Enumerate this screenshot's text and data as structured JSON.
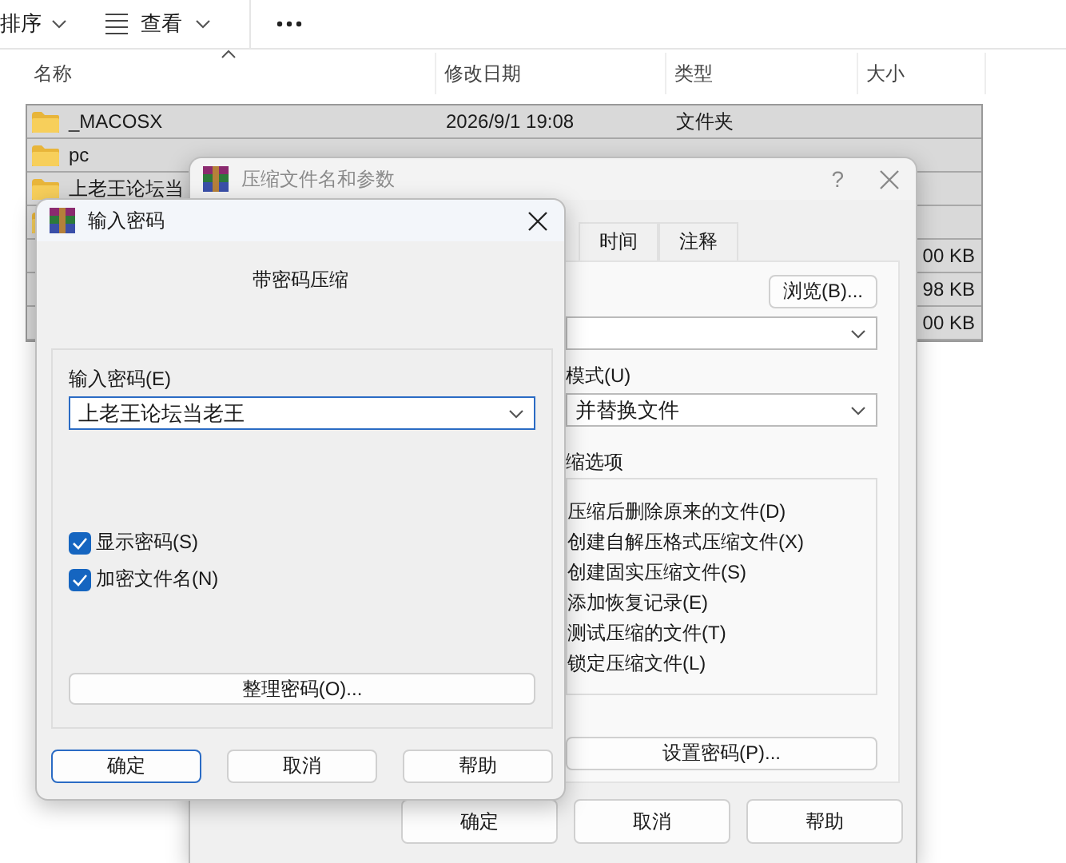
{
  "explorer": {
    "toolbar": [
      {
        "label": "排序",
        "kind": "dropdown"
      },
      {
        "label": "查看",
        "kind": "view"
      },
      {
        "kind": "more"
      }
    ],
    "columns": [
      "名称",
      "修改日期",
      "类型",
      "大小"
    ],
    "rows": [
      {
        "kind": "folder",
        "name": "_MACOSX",
        "date": "2026/9/1 19:08",
        "type": "文件夹",
        "selected": true
      },
      {
        "kind": "folder",
        "name": "pc",
        "selected": true
      },
      {
        "kind": "folder",
        "name": "上老王论坛当",
        "selected": true
      },
      {
        "kind": "folder",
        "selected": true
      },
      {
        "kind": "file",
        "size": "00 KB",
        "selected": true
      },
      {
        "kind": "file",
        "size": "98 KB",
        "selected": true
      },
      {
        "kind": "file",
        "size": "00 KB",
        "selected": true
      }
    ]
  },
  "archive_dialog": {
    "title": "压缩文件名和参数",
    "active": false,
    "help_glyph": "?",
    "tabs": [
      {
        "label": "时间"
      },
      {
        "label": "注释"
      }
    ],
    "browse_button": "浏览(B)...",
    "update_mode_label": "模式(U)",
    "update_mode_value": "并替换文件",
    "options_label": "缩选项",
    "options": [
      "压缩后删除原来的文件(D)",
      "创建自解压格式压缩文件(X)",
      "创建固实压缩文件(S)",
      "添加恢复记录(E)",
      "测试压缩的文件(T)",
      "锁定压缩文件(L)"
    ],
    "password_button": "设置密码(P)...",
    "buttons": [
      {
        "label": "确定",
        "default": false
      },
      {
        "label": "取消",
        "default": false
      },
      {
        "label": "帮助",
        "default": false
      }
    ]
  },
  "password_dialog": {
    "title": "输入密码",
    "active": true,
    "subtitle": "带密码压缩",
    "password_label": "输入密码(E)",
    "password_value": "上老王论坛当老王",
    "options": [
      {
        "label": "显示密码(S)",
        "checked": true
      },
      {
        "label": "加密文件名(N)",
        "checked": true
      }
    ],
    "organize_button": "整理密码(O)...",
    "buttons": [
      {
        "label": "确定",
        "default": true
      },
      {
        "label": "取消",
        "default": false
      },
      {
        "label": "帮助",
        "default": false
      }
    ]
  }
}
